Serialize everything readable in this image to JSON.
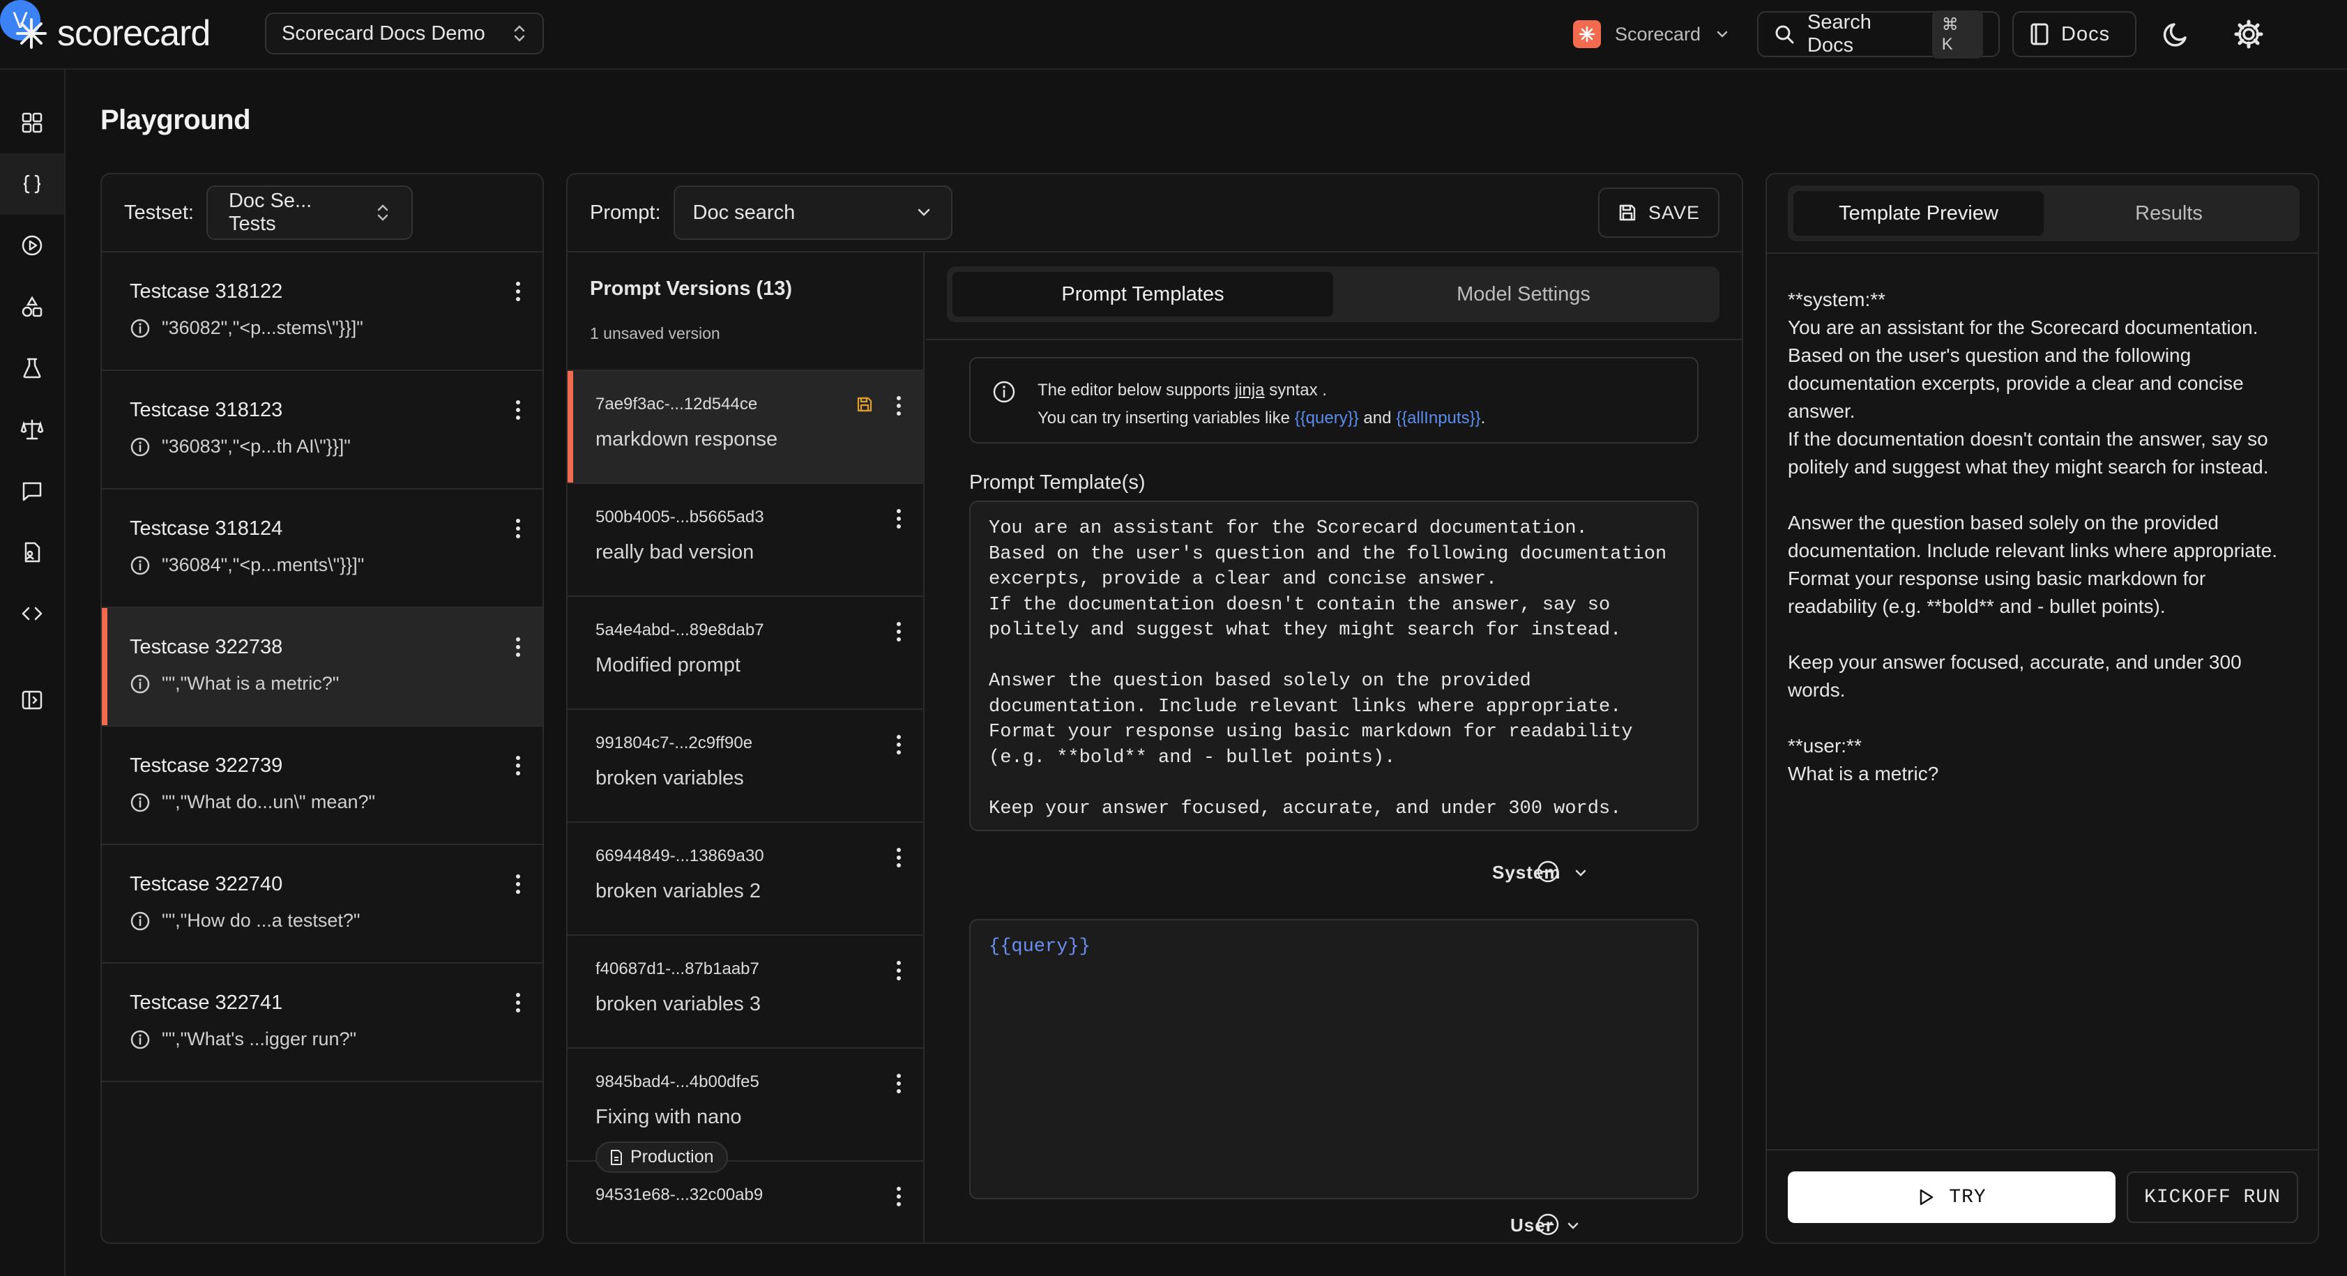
{
  "app": {
    "brand": "scorecard",
    "project": "Scorecard Docs Demo",
    "org": "Scorecard",
    "search_label": "Search Docs",
    "search_shortcut": "⌘ K",
    "docs_label": "Docs",
    "avatar_initial": "V",
    "accent_color": "#f26b4e"
  },
  "sidebar": {
    "icons": [
      "dashboard-icon",
      "braces-icon",
      "play-icon",
      "shapes-icon",
      "flask-icon",
      "scale-icon",
      "message-icon",
      "file-user-icon",
      "code-icon",
      "panel-toggle-icon"
    ],
    "active_index": 1
  },
  "page": {
    "title": "Playground"
  },
  "testset": {
    "label": "Testset:",
    "selected": "Doc Se... Tests",
    "testcases": [
      {
        "title": "Testcase 318122",
        "preview": "\"36082\",\"<p...stems\\\"}}]\""
      },
      {
        "title": "Testcase 318123",
        "preview": "\"36083\",\"<p...th AI\\\"}}]\""
      },
      {
        "title": "Testcase 318124",
        "preview": "\"36084\",\"<p...ments\\\"}}]\""
      },
      {
        "title": "Testcase 322738",
        "preview": "\"\",\"What is a metric?\""
      },
      {
        "title": "Testcase 322739",
        "preview": "\"\",\"What do...un\\\" mean?\""
      },
      {
        "title": "Testcase 322740",
        "preview": "\"\",\"How do ...a testset?\""
      },
      {
        "title": "Testcase 322741",
        "preview": "\"\",\"What's ...igger run?\""
      }
    ],
    "active_index": 3
  },
  "prompt": {
    "label": "Prompt:",
    "selected": "Doc search",
    "save_label": "SAVE",
    "versions_title": "Prompt Versions (13)",
    "versions_sub": "1 unsaved version",
    "versions": [
      {
        "id": "7ae9f3ac-...12d544ce",
        "name": "markdown response",
        "badge": ""
      },
      {
        "id": "500b4005-...b5665ad3",
        "name": "really bad version",
        "badge": ""
      },
      {
        "id": "5a4e4abd-...89e8dab7",
        "name": "Modified prompt",
        "badge": ""
      },
      {
        "id": "991804c7-...2c9ff90e",
        "name": "broken variables",
        "badge": ""
      },
      {
        "id": "66944849-...13869a30",
        "name": "broken variables 2",
        "badge": ""
      },
      {
        "id": "f40687d1-...87b1aab7",
        "name": "broken variables 3",
        "badge": ""
      },
      {
        "id": "9845bad4-...4b00dfe5",
        "name": "Fixing with nano",
        "badge": "Production"
      },
      {
        "id": "94531e68-...32c00ab9",
        "name": "",
        "badge": ""
      }
    ],
    "active_version": 0
  },
  "editor": {
    "tabs": [
      "Prompt Templates",
      "Model Settings"
    ],
    "active_tab": 0,
    "info_line1_pre": "The editor below supports ",
    "info_link_jinja": "jinja",
    "info_line1_post": " syntax .",
    "info_line2_pre": "You can try inserting variables like ",
    "info_var1": "{{query}}",
    "info_and": " and ",
    "info_var2": "{{allInputs}}",
    "info_end": ".",
    "templates_label": "Prompt Template(s)",
    "system_text": "You are an assistant for the Scorecard documentation.\nBased on the user's question and the following documentation\nexcerpts, provide a clear and concise answer.\nIf the documentation doesn't contain the answer, say so\npolitely and suggest what they might search for instead.\n\nAnswer the question based solely on the provided\ndocumentation. Include relevant links where appropriate.\nFormat your response using basic markdown for readability\n(e.g. **bold** and - bullet points).\n\nKeep your answer focused, accurate, and under 300 words.",
    "system_role": "System",
    "user_text": "{{query}}",
    "user_role": "User"
  },
  "preview": {
    "tabs": [
      "Template Preview",
      "Results"
    ],
    "active_tab": 0,
    "lines": [
      "**system:**",
      "You are an assistant for the Scorecard documentation.",
      "Based on the user's question and the following",
      "documentation excerpts, provide a clear and concise",
      "answer.",
      "If the documentation doesn't contain the answer, say so",
      "politely and suggest what they might search for instead.",
      "",
      "Answer the question based solely on the provided",
      "documentation. Include relevant links where appropriate.",
      "Format your response using basic markdown for",
      "readability (e.g. **bold** and - bullet points).",
      "",
      "Keep your answer focused, accurate, and under 300",
      "words.",
      "",
      "**user:**",
      "What is a metric?"
    ],
    "try_label": "TRY",
    "kickoff_label": "KICKOFF RUN"
  }
}
